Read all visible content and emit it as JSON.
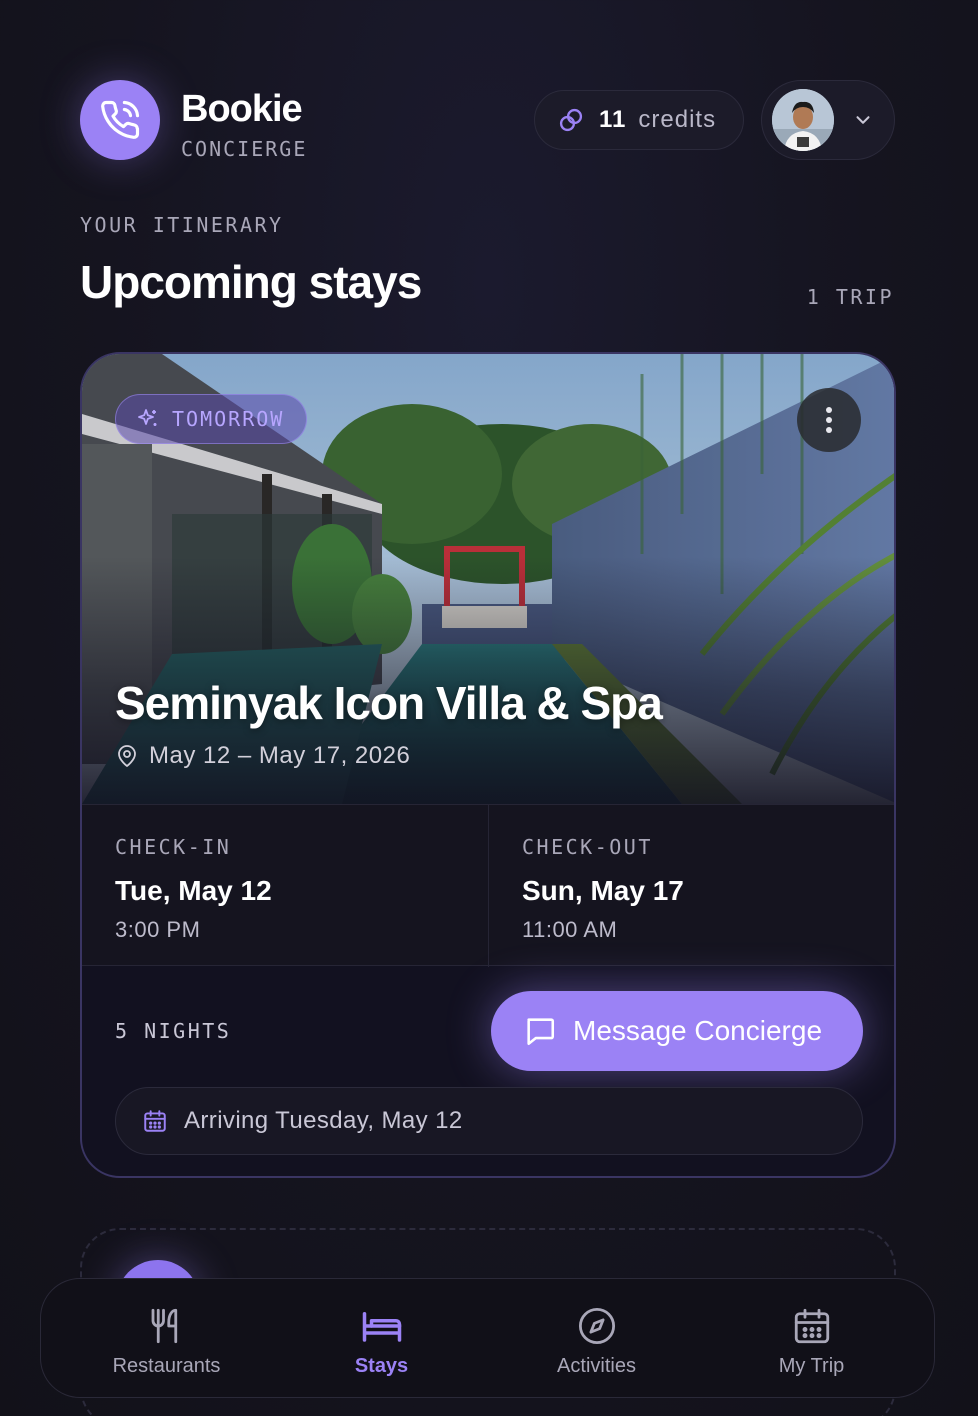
{
  "header": {
    "brand_name": "Bookie",
    "brand_sub": "CONCIERGE",
    "credits_count": "11",
    "credits_label": "credits"
  },
  "section": {
    "eyebrow": "YOUR ITINERARY",
    "title": "Upcoming stays",
    "trip_count": "1 TRIP"
  },
  "stay": {
    "badge": "TOMORROW",
    "name": "Seminyak Icon Villa & Spa",
    "dates": "May 12 – May 17, 2026",
    "checkin_label": "CHECK-IN",
    "checkin_date": "Tue, May 12",
    "checkin_time": "3:00 PM",
    "checkout_label": "CHECK-OUT",
    "checkout_date": "Sun, May 17",
    "checkout_time": "11:00 AM",
    "nights": "5 NIGHTS",
    "message_button": "Message Concierge",
    "arriving": "Arriving Tuesday, May 12"
  },
  "nav": {
    "items": [
      {
        "label": "Restaurants",
        "icon": "fork-knife-icon"
      },
      {
        "label": "Stays",
        "icon": "bed-icon"
      },
      {
        "label": "Activities",
        "icon": "compass-icon"
      },
      {
        "label": "My Trip",
        "icon": "calendar-icon"
      }
    ],
    "active": "Stays"
  },
  "colors": {
    "accent": "#9b82f5",
    "background": "#15141f",
    "card_border": "#3a3563"
  }
}
